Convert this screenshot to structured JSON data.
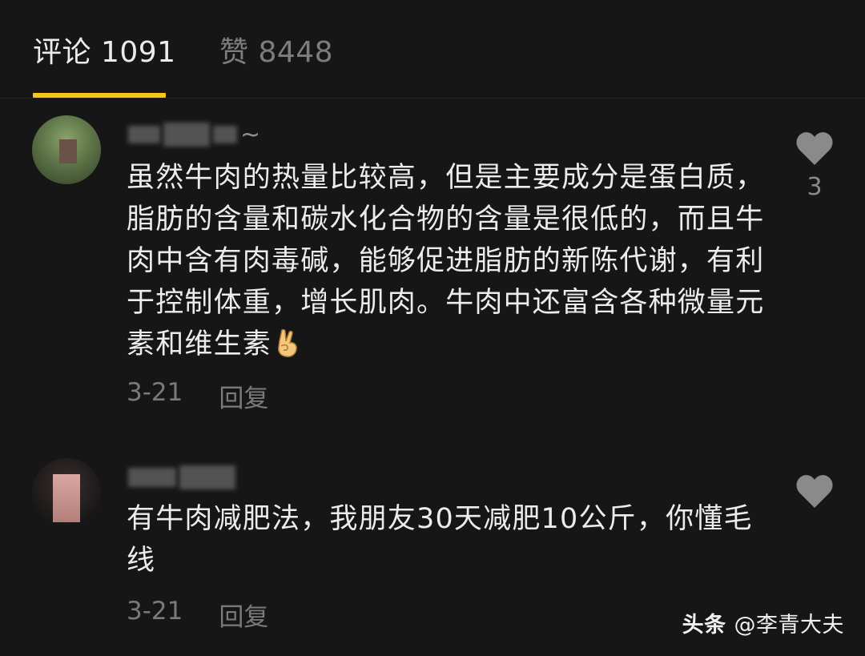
{
  "tabs": {
    "comments_label": "评论 1091",
    "likes_label": "赞 8448",
    "active_color": "#f5c518"
  },
  "comments": [
    {
      "username_suffix": "~",
      "text": "虽然牛肉的热量比较高，但是主要成分是蛋白质，脂肪的含量和碳水化合物的含量是很低的，而且牛肉中含有肉毒碱，能够促进脂肪的新陈代谢，有利于控制体重，增长肌肉。牛肉中还富含各种微量元素和维生素",
      "emoji": "victory-hand-emoji",
      "date": "3-21",
      "reply_label": "回复",
      "like_count": "3"
    },
    {
      "text": "有牛肉减肥法，我朋友30天减肥10公斤，你懂毛线",
      "date": "3-21",
      "reply_label": "回复",
      "like_count": ""
    }
  ],
  "watermark": {
    "brand": "头条",
    "handle": "@李青大夫"
  }
}
